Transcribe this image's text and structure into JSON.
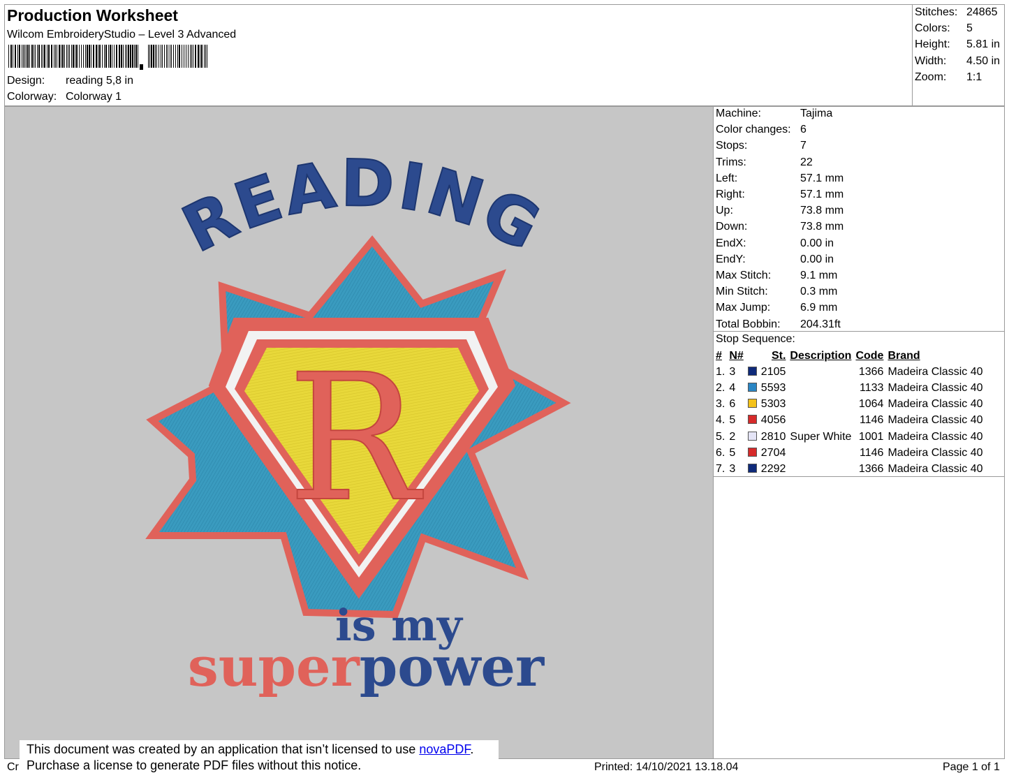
{
  "header": {
    "title": "Production Worksheet",
    "subtitle": "Wilcom EmbroideryStudio – Level 3 Advanced",
    "design_label": "Design:",
    "design_value": "reading 5,8 in",
    "colorway_label": "Colorway:",
    "colorway_value": "Colorway 1"
  },
  "stats": [
    {
      "k": "Stitches:",
      "v": "24865"
    },
    {
      "k": "Colors:",
      "v": "5"
    },
    {
      "k": "Height:",
      "v": "5.81 in"
    },
    {
      "k": "Width:",
      "v": "4.50 in"
    },
    {
      "k": "Zoom:",
      "v": "1:1"
    }
  ],
  "specs": [
    {
      "k": "Machine:",
      "v": "Tajima"
    },
    {
      "k": "Color changes:",
      "v": "6"
    },
    {
      "k": "Stops:",
      "v": "7"
    },
    {
      "k": "Trims:",
      "v": "22"
    },
    {
      "k": "Left:",
      "v": "57.1 mm"
    },
    {
      "k": "Right:",
      "v": "57.1 mm"
    },
    {
      "k": "Up:",
      "v": "73.8 mm"
    },
    {
      "k": "Down:",
      "v": "73.8 mm"
    },
    {
      "k": "EndX:",
      "v": "0.00 in"
    },
    {
      "k": "EndY:",
      "v": "0.00 in"
    },
    {
      "k": "Max Stitch:",
      "v": "9.1 mm"
    },
    {
      "k": "Min Stitch:",
      "v": "0.3 mm"
    },
    {
      "k": "Max Jump:",
      "v": "6.9 mm"
    },
    {
      "k": "Total Bobbin:",
      "v": "204.31ft"
    }
  ],
  "stop_sequence": {
    "title": "Stop Sequence:",
    "headers": [
      "#",
      "N#",
      "St.",
      "Description",
      "Code",
      "Brand"
    ],
    "rows": [
      {
        "n": "1.",
        "nn": "3",
        "color": "#0f2a7a",
        "st": "2105",
        "desc": "",
        "code": "1366",
        "brand": "Madeira Classic 40"
      },
      {
        "n": "2.",
        "nn": "4",
        "color": "#2a86c4",
        "st": "5593",
        "desc": "",
        "code": "1133",
        "brand": "Madeira Classic 40"
      },
      {
        "n": "3.",
        "nn": "6",
        "color": "#f4c21a",
        "st": "5303",
        "desc": "",
        "code": "1064",
        "brand": "Madeira Classic 40"
      },
      {
        "n": "4.",
        "nn": "5",
        "color": "#d62a2a",
        "st": "4056",
        "desc": "",
        "code": "1146",
        "brand": "Madeira Classic 40"
      },
      {
        "n": "5.",
        "nn": "2",
        "color": "#e4e4f6",
        "st": "2810",
        "desc": "Super White",
        "code": "1001",
        "brand": "Madeira Classic 40"
      },
      {
        "n": "6.",
        "nn": "5",
        "color": "#d62a2a",
        "st": "2704",
        "desc": "",
        "code": "1146",
        "brand": "Madeira Classic 40"
      },
      {
        "n": "7.",
        "nn": "3",
        "color": "#0f2a7a",
        "st": "2292",
        "desc": "",
        "code": "1366",
        "brand": "Madeira Classic 40"
      }
    ]
  },
  "design_art": {
    "word1": "READING",
    "letter": "R",
    "line2": "is my",
    "line3a": "super",
    "line3b": "power",
    "colors": {
      "navy": "#2c4a8e",
      "coral": "#e0625a",
      "teal": "#3a9bbf",
      "yellow": "#e8d83a",
      "white": "#f2f2f2",
      "bg": "#c6c6c6"
    }
  },
  "footer": {
    "left_fragment": "Cr",
    "printed": "Printed: 14/10/2021 13.18.04",
    "page": "Page 1 of 1",
    "notice_line1": "This document was created by an application that isn’t licensed to use ",
    "notice_link": "novaPDF",
    "notice_line1_end": ".",
    "notice_line2": "Purchase a license to generate PDF files without this notice."
  }
}
